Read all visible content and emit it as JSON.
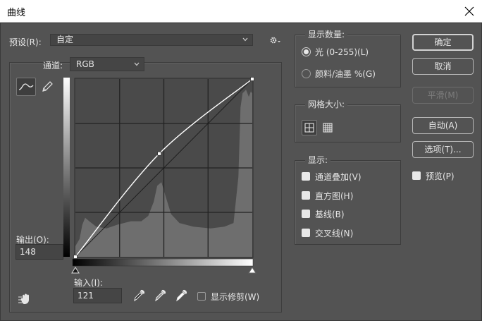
{
  "window": {
    "title": "曲线"
  },
  "preset": {
    "label": "预设(R):",
    "value": "自定"
  },
  "channel": {
    "label": "通道:",
    "value": "RGB"
  },
  "output": {
    "label": "输出(O):",
    "value": "148"
  },
  "input": {
    "label": "输入(I):",
    "value": "121"
  },
  "show_clipping": {
    "label": "显示修剪(W)",
    "checked": false
  },
  "show_amount": {
    "title": "显示数量:",
    "options": [
      {
        "label": "光 (0-255)(L)",
        "selected": true
      },
      {
        "label": "颜料/油墨 %(G)",
        "selected": false
      }
    ]
  },
  "grid_size": {
    "title": "网格大小:",
    "options": [
      "simple-grid-icon",
      "detailed-grid-icon"
    ]
  },
  "show": {
    "title": "显示:",
    "items": [
      {
        "label": "通道叠加(V)",
        "checked": true
      },
      {
        "label": "直方图(H)",
        "checked": true
      },
      {
        "label": "基线(B)",
        "checked": true
      },
      {
        "label": "交叉线(N)",
        "checked": true
      }
    ]
  },
  "buttons": {
    "ok": "确定",
    "cancel": "取消",
    "smooth": "平滑(M)",
    "auto": "自动(A)",
    "options": "选项(T)..."
  },
  "preview": {
    "label": "预览(P)",
    "checked": true
  },
  "curve": {
    "control_points": [
      {
        "input": 0,
        "output": 0
      },
      {
        "input": 121,
        "output": 148
      },
      {
        "input": 255,
        "output": 255
      }
    ],
    "histogram_profile": [
      {
        "input": 0,
        "level": 0.06
      },
      {
        "input": 6,
        "level": 0.1
      },
      {
        "input": 10,
        "level": 0.18
      },
      {
        "input": 14,
        "level": 0.22
      },
      {
        "input": 20,
        "level": 0.2
      },
      {
        "input": 30,
        "level": 0.17
      },
      {
        "input": 45,
        "level": 0.16
      },
      {
        "input": 60,
        "level": 0.18
      },
      {
        "input": 70,
        "level": 0.19
      },
      {
        "input": 80,
        "level": 0.2
      },
      {
        "input": 95,
        "level": 0.2
      },
      {
        "input": 105,
        "level": 0.23
      },
      {
        "input": 113,
        "level": 0.31
      },
      {
        "input": 118,
        "level": 0.4
      },
      {
        "input": 124,
        "level": 0.42
      },
      {
        "input": 130,
        "level": 0.34
      },
      {
        "input": 138,
        "level": 0.24
      },
      {
        "input": 150,
        "level": 0.19
      },
      {
        "input": 170,
        "level": 0.17
      },
      {
        "input": 195,
        "level": 0.16
      },
      {
        "input": 215,
        "level": 0.17
      },
      {
        "input": 228,
        "level": 0.19
      },
      {
        "input": 235,
        "level": 0.45
      },
      {
        "input": 238,
        "level": 0.84
      },
      {
        "input": 241,
        "level": 0.92
      },
      {
        "input": 246,
        "level": 0.94
      },
      {
        "input": 250,
        "level": 0.9
      },
      {
        "input": 253,
        "level": 0.93
      },
      {
        "input": 255,
        "level": 0.92
      }
    ],
    "shadow_slider_input": 0,
    "highlight_slider_input": 255
  },
  "tools": {
    "curve_point": "curve-point-tool-icon",
    "pencil": "pencil-icon",
    "settings": "gear-icon",
    "target_adjust": "hand-target-icon",
    "black_point": "black-eyedropper-icon",
    "gray_point": "gray-eyedropper-icon",
    "white_point": "white-eyedropper-icon"
  },
  "colors": {
    "background": "#535353",
    "graph_bg": "#4a4a4a",
    "histogram": "#6e6e6e",
    "curve": "#ffffff",
    "title_bar": "#ffffff"
  }
}
